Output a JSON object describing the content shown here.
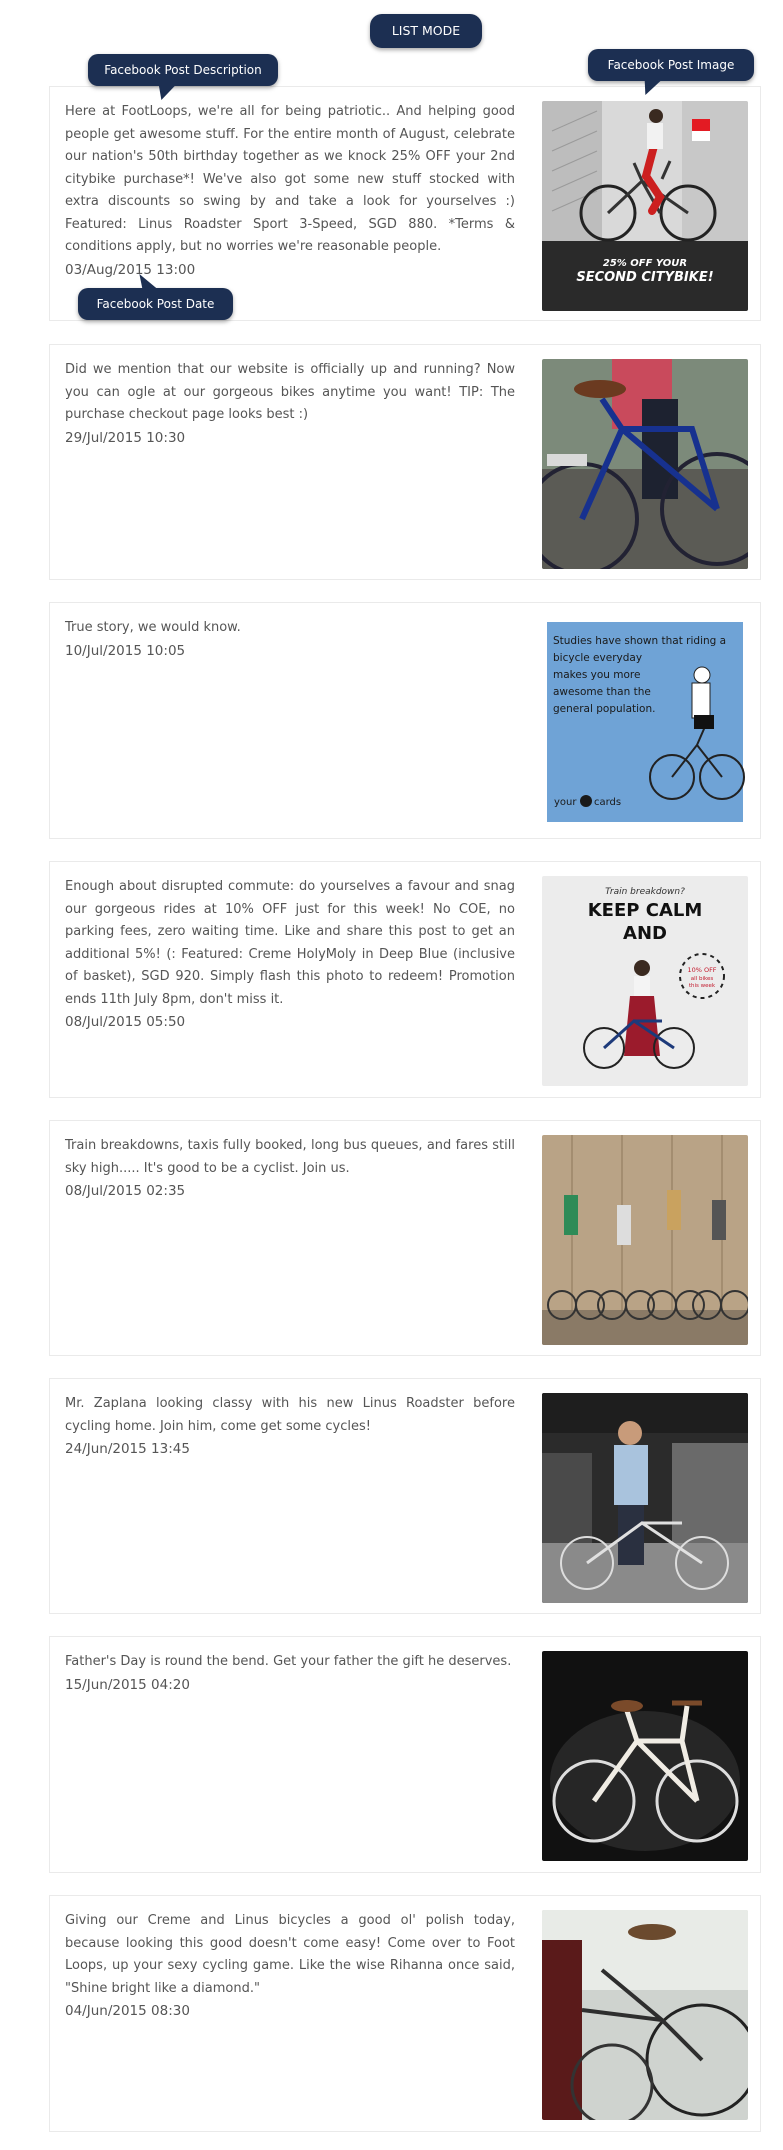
{
  "header": {
    "mode_label": "LIST MODE"
  },
  "annotations": {
    "description": "Facebook Post Description",
    "image": "Facebook Post Image",
    "date": "Facebook Post Date"
  },
  "posts": [
    {
      "text": "Here at FootLoops, we're all for being patriotic.. And helping good people get awesome stuff. For the entire month of August, celebrate our nation's 50th birthday together as we knock 25% OFF your 2nd citybike purchase*! We've also got some new stuff stocked with extra discounts so swing by and take a look for yourselves :) Featured: Linus Roadster Sport 3-Speed, SGD 880. *Terms & conditions apply, but no worries we're reasonable people.",
      "date": "03/Aug/2015 13:00",
      "image": "bike-promo-image",
      "image_text": [
        "25% OFF YOUR",
        "SECOND CITYBIKE!"
      ]
    },
    {
      "text": "Did we mention that our website is officially up and running? Now you can ogle at our gorgeous bikes anytime you want! TIP: The purchase checkout page looks best :)",
      "date": "29/Jul/2015 10:30",
      "image": "blue-bike-image"
    },
    {
      "text": "True story, we would know.",
      "date": "10/Jul/2015 10:05",
      "image": "cyclist-card-image",
      "image_text": [
        "Studies have shown that riding a",
        "bicycle everyday",
        "makes you more",
        "awesome than the",
        "general population.",
        "your",
        "cards"
      ]
    },
    {
      "text": "Enough about disrupted commute: do yourselves a favour and snag our gorgeous rides at 10% OFF just for this week! No COE, no parking fees, zero waiting time. Like and share this post to get an additional 5%! (: Featured: Creme HolyMoly in Deep Blue (inclusive of basket), SGD 920. Simply flash this photo to redeem! Promotion ends 11th July 8pm, don't miss it.",
      "date": "08/Jul/2015 05:50",
      "image": "keep-calm-image",
      "image_text": [
        "Train breakdown?",
        "KEEP CALM",
        "AND",
        "10% OFF",
        "all bikes",
        "this week"
      ]
    },
    {
      "text": "Train breakdowns, taxis fully booked, long bus queues, and fares still sky high..... It's good to be a cyclist. Join us.",
      "date": "08/Jul/2015 02:35",
      "image": "jumping-cyclists-image"
    },
    {
      "text": "Mr. Zaplana looking classy with his new Linus Roadster before cycling home. Join him, come get some cycles!",
      "date": "24/Jun/2015 13:45",
      "image": "shop-customer-image"
    },
    {
      "text": "Father's Day is round the bend. Get your father the gift he deserves.",
      "date": "15/Jun/2015 04:20",
      "image": "white-bike-image"
    },
    {
      "text": "Giving our Creme and Linus bicycles a good ol' polish today, because looking this good doesn't come easy! Come over to Foot Loops, up your sexy cycling game. Like the wise Rihanna once said, \"Shine bright like a diamond.\"",
      "date": "04/Jun/2015 08:30",
      "image": "bike-closeup-image"
    }
  ],
  "colors": {
    "pill": "#1c2f52",
    "text": "#555555",
    "border": "#eaeaea"
  }
}
